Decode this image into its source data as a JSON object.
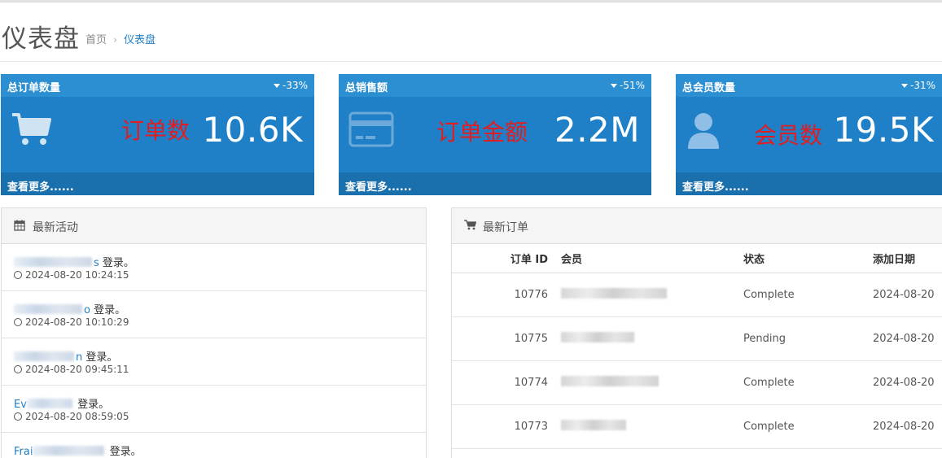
{
  "page": {
    "title": "仪表盘",
    "breadcrumb": {
      "home": "首页",
      "separator": "›",
      "current": "仪表盘"
    }
  },
  "tiles": [
    {
      "title": "总订单数量",
      "change": "-33%",
      "note": "订单数",
      "value": "10.6K",
      "footer": "查看更多......",
      "icon": "shopping-cart-icon"
    },
    {
      "title": "总销售额",
      "change": "-51%",
      "note": "订单金额",
      "value": "2.2M",
      "footer": "查看更多......",
      "icon": "credit-card-icon"
    },
    {
      "title": "总会员数量",
      "change": "-31%",
      "note": "会员数",
      "value": "19.5K",
      "footer": "查看更多......",
      "icon": "user-icon"
    }
  ],
  "activity": {
    "title": "最新活动",
    "icon": "calendar-icon",
    "items": [
      {
        "name_visible": "s",
        "action": "登录。",
        "time": "2024-08-20 10:24:15"
      },
      {
        "name_visible": "o",
        "action": "登录。",
        "time": "2024-08-20 10:10:29"
      },
      {
        "name_visible": "n",
        "action": "登录。",
        "time": "2024-08-20 09:45:11"
      },
      {
        "name_visible": "Ev",
        "action": "登录。",
        "time": "2024-08-20 08:59:05"
      },
      {
        "name_visible": "Frai",
        "action": "登录。",
        "time": ""
      }
    ]
  },
  "orders": {
    "title": "最新订单",
    "icon": "cart-icon",
    "columns": [
      "订单 ID",
      "会员",
      "状态",
      "添加日期"
    ],
    "rows": [
      {
        "id": "10776",
        "status": "Complete",
        "date": "2024-08-20"
      },
      {
        "id": "10775",
        "status": "Pending",
        "date": "2024-08-20"
      },
      {
        "id": "10774",
        "status": "Complete",
        "date": "2024-08-20"
      },
      {
        "id": "10773",
        "status": "Complete",
        "date": "2024-08-20"
      }
    ]
  },
  "colors": {
    "tile_bg": "#1f80c8",
    "tile_head": "#2b8fd1",
    "tile_foot": "#1a6fad",
    "note_red": "#e01e22",
    "link_blue": "#1e7ec3"
  }
}
